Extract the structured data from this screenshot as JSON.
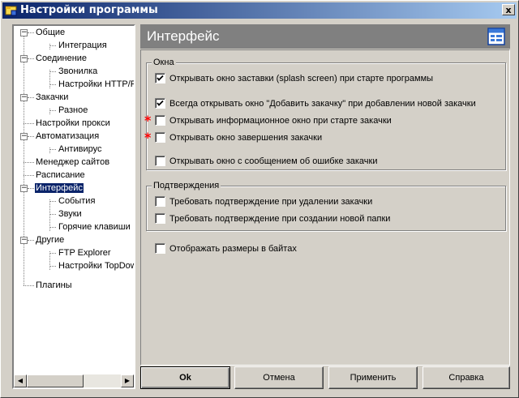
{
  "window": {
    "title": "Настройки программы",
    "close_label": "x"
  },
  "tree": {
    "items": [
      {
        "label": "Общие"
      },
      {
        "label": "Интеграция"
      },
      {
        "label": "Соединение"
      },
      {
        "label": "Звонилка"
      },
      {
        "label": "Настройки HTTP/FTP"
      },
      {
        "label": "Закачки"
      },
      {
        "label": "Разное"
      },
      {
        "label": "Настройки прокси"
      },
      {
        "label": "Автоматизация"
      },
      {
        "label": "Антивирус"
      },
      {
        "label": "Менеджер сайтов"
      },
      {
        "label": "Расписание"
      },
      {
        "label": "Интерфейс"
      },
      {
        "label": "События"
      },
      {
        "label": "Звуки"
      },
      {
        "label": "Горячие клавиши"
      },
      {
        "label": "Другие"
      },
      {
        "label": "FTP Explorer"
      },
      {
        "label": "Настройки TopDownloader"
      },
      {
        "label": "Плагины"
      }
    ],
    "selected": "Интерфейс"
  },
  "header": {
    "title": "Интерфейс"
  },
  "groups": {
    "windows": {
      "title": "Окна",
      "options": [
        {
          "label": "Открывать окно заставки (splash screen) при старте программы",
          "checked": true
        },
        {
          "label": "Всегда открывать окно \"Добавить закачку\" при добавлении новой закачки",
          "checked": true
        },
        {
          "label": "Открывать информационное окно при старте закачки",
          "checked": false
        },
        {
          "label": "Открывать окно завершения закачки",
          "checked": false
        },
        {
          "label": "Открывать окно с сообщением об ошибке закачки",
          "checked": false
        }
      ]
    },
    "confirm": {
      "title": "Подтверждения",
      "options": [
        {
          "label": "Требовать подтверждение при удалении закачки",
          "checked": false
        },
        {
          "label": "Требовать подтверждение при создании новой папки",
          "checked": false
        }
      ]
    },
    "sizes": {
      "label": "Отображать размеры в байтах",
      "checked": false
    }
  },
  "markers": {
    "star": "*"
  },
  "buttons": {
    "ok": "Ok",
    "cancel": "Отмена",
    "apply": "Применить",
    "help": "Справка"
  }
}
